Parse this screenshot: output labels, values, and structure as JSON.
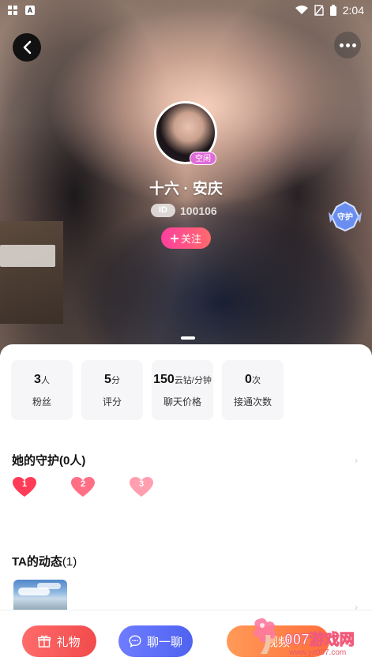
{
  "status_bar": {
    "time": "2:04",
    "icons": [
      "grid-icon",
      "a-icon",
      "wifi-icon",
      "no-sim-icon",
      "battery-icon"
    ]
  },
  "profile": {
    "name": "十六 · 安庆",
    "status": "空闲",
    "id_label": "ID",
    "id_number": "100106",
    "follow_label": "关注",
    "guard_badge": "守护"
  },
  "stats": [
    {
      "num": "3",
      "unit": "人",
      "label": "粉丝"
    },
    {
      "num": "5",
      "unit": "分",
      "label": "评分"
    },
    {
      "num": "150",
      "unit": "云钻/分钟",
      "label": "聊天价格"
    },
    {
      "num": "0",
      "unit": "次",
      "label": "接通次数"
    }
  ],
  "guardians": {
    "title": "她的守护(0人)",
    "ranks": [
      "1",
      "2",
      "3"
    ]
  },
  "moments": {
    "title": "TA的动态",
    "count": "(1)"
  },
  "bottom_bar": {
    "gift_label": "礼物",
    "chat_label": "聊一聊",
    "video_label": "视频"
  },
  "watermark": {
    "text": "007游戏网",
    "url": "www.yx007.com"
  },
  "colors": {
    "pink": "#ff3fa0",
    "gift": "#f24b4b",
    "chat": "#4f63f0",
    "video": "#ff6e3c"
  }
}
